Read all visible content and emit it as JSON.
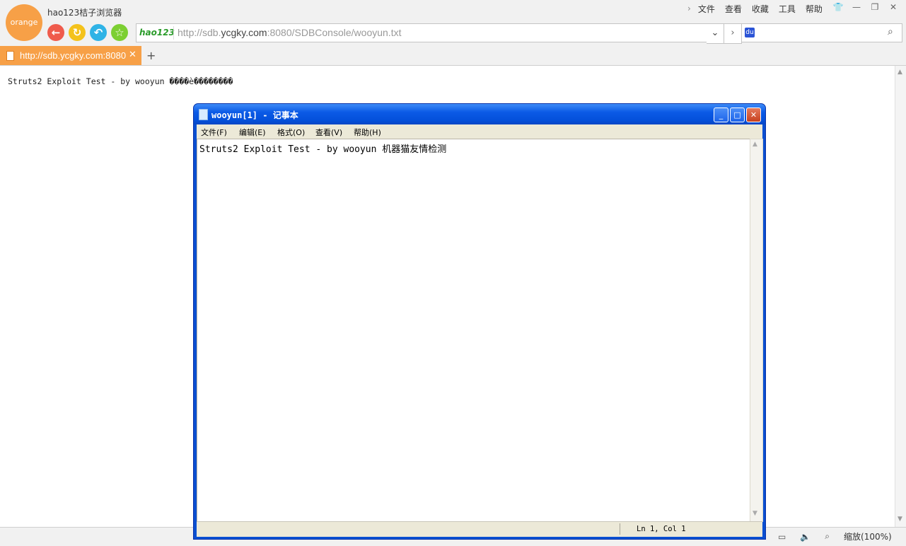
{
  "browser": {
    "logo_text": "orange",
    "app_title": "hao123桔子浏览器",
    "menu": [
      "文件",
      "查看",
      "收藏",
      "工具",
      "帮助"
    ],
    "address": {
      "logo_text": "hao123",
      "url_prefix": "http://sdb.",
      "url_domain": "ycgky.com",
      "url_suffix": ":8080/SDBConsole/wooyun.txt"
    },
    "search": {
      "placeholder": ""
    },
    "tab": {
      "title": "http://sdb.ycgky.com:8080"
    },
    "content_text": "Struts2 Exploit Test - by wooyun ����è��������",
    "status": {
      "zoom": "缩放(100%)"
    }
  },
  "notepad": {
    "title": "wooyun[1] - 记事本",
    "menu": [
      "文件(F)",
      "编辑(E)",
      "格式(O)",
      "查看(V)",
      "帮助(H)"
    ],
    "text": "Struts2 Exploit Test - by wooyun 机器猫友情检测",
    "cursor_pos": "Ln 1, Col 1"
  },
  "colors": {
    "accent": "#f7a047",
    "xp_title_blue": "#0b5ae6"
  }
}
